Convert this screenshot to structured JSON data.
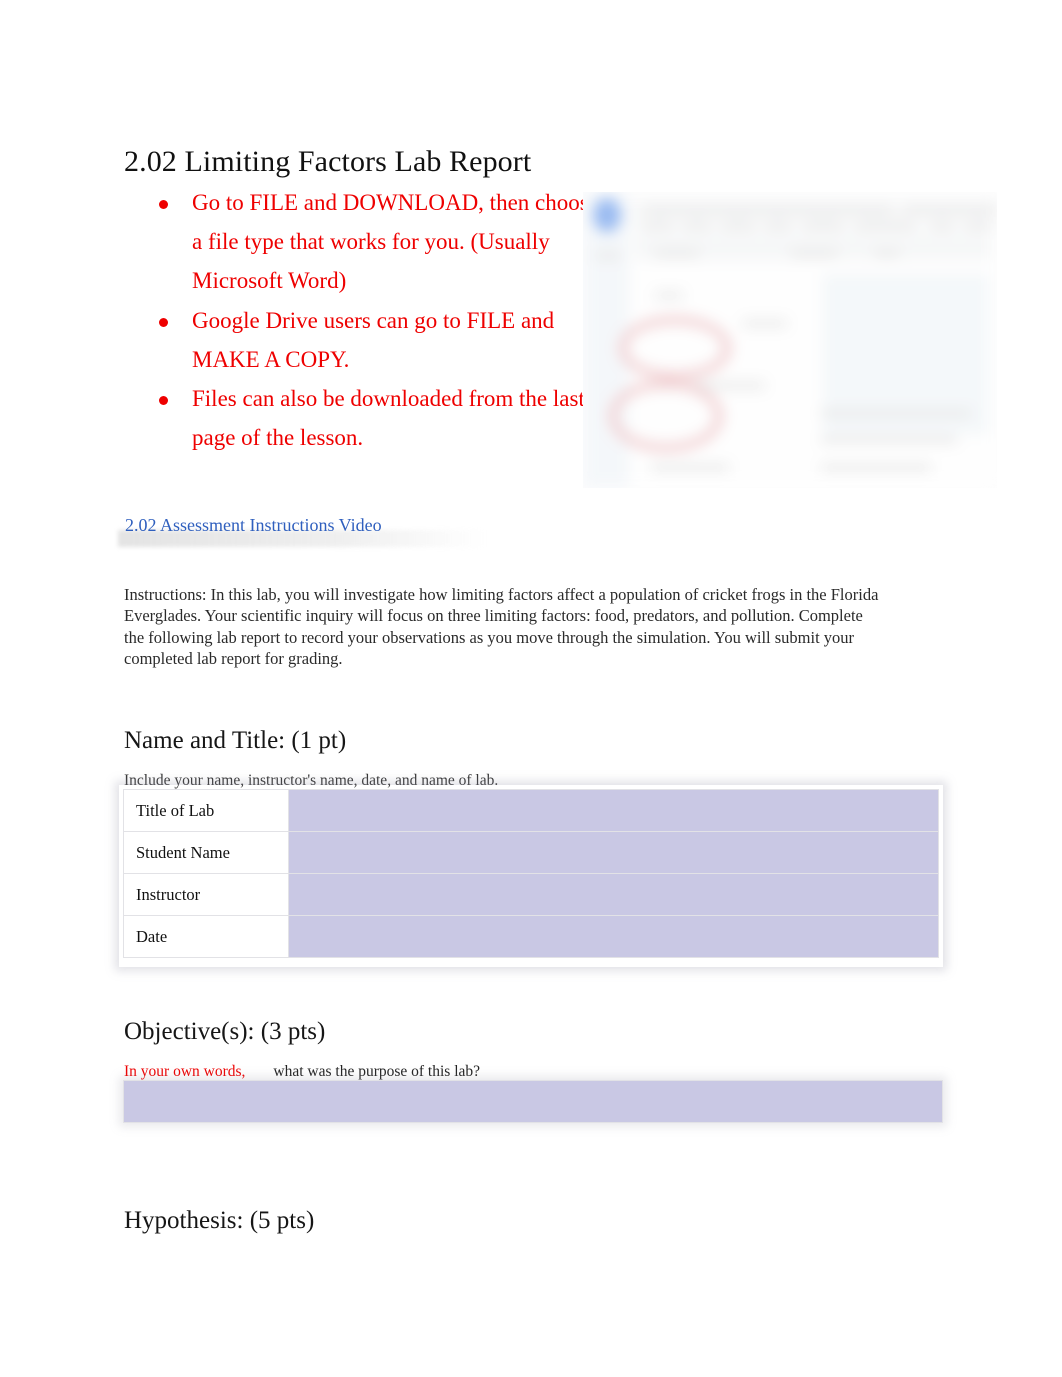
{
  "document": {
    "title": "2.02 Limiting Factors Lab Report"
  },
  "notice": {
    "items": [
      "Go to FILE and DOWNLOAD, then choose a file type that works for you. (Usually Microsoft Word)",
      "Google Drive users can go to FILE and MAKE A COPY.",
      "Files can also be downloaded from the last page of the lesson."
    ]
  },
  "figure": {
    "caption": "blurred screenshot of document editor with red circle annotations"
  },
  "video": {
    "link_label": "2.02 Assessment Instructions Video"
  },
  "instructions": {
    "text": "Instructions: In this lab, you will investigate how limiting factors affect a population of cricket frogs in the Florida Everglades. Your scientific inquiry will focus on three limiting factors: food, predators, and pollution. Complete the following lab report to record your observations as you move through the simulation. You will submit your completed lab report for grading."
  },
  "sections": {
    "name_and_title": {
      "heading": "Name and Title: (1 pt)",
      "note": "Include your name, instructor's name, date, and name of lab.",
      "rows": [
        {
          "label": "Title of Lab",
          "value": ""
        },
        {
          "label": "Student Name",
          "value": ""
        },
        {
          "label": "Instructor",
          "value": ""
        },
        {
          "label": "Date",
          "value": ""
        }
      ]
    },
    "objectives": {
      "heading": "Objective(s): (3 pts)",
      "prompt_red": "In your own words,",
      "prompt_black": "what was the purpose of this lab?",
      "answer": ""
    },
    "hypothesis": {
      "heading": "Hypothesis:    (5 pts)"
    }
  },
  "colors": {
    "notice_red": "#ee0000",
    "link_blue": "#2f5fbe",
    "field_lavender": "#c9c8e4",
    "page_background": "#ffffff",
    "body_text": "#222222"
  }
}
